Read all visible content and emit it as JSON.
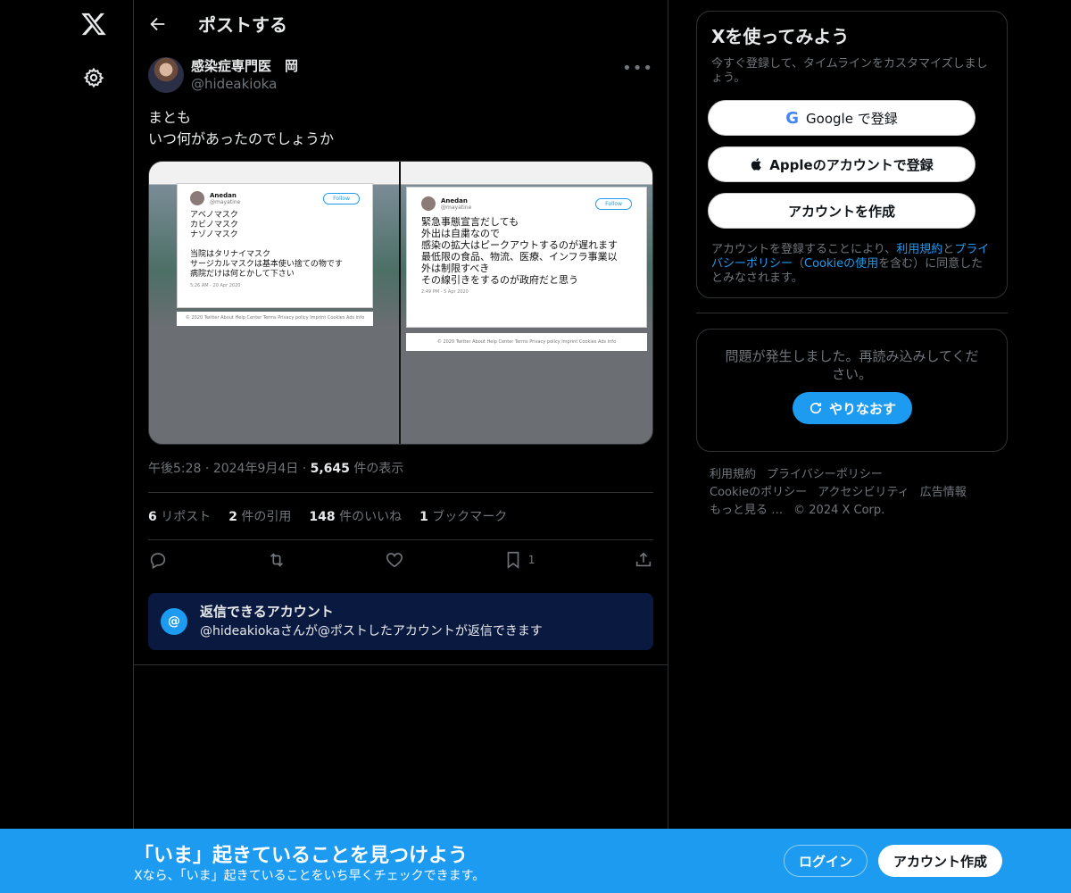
{
  "nav": {
    "logo": "X"
  },
  "header": {
    "title": "ポストする"
  },
  "tweet": {
    "display_name": "感染症専門医　岡",
    "handle": "@hideakioka",
    "text": "まとも\nいつ何があったのでしょうか",
    "time": "午後5:28",
    "date": "2024年9月4日",
    "views_count": "5,645",
    "views_label": "件の表示",
    "stats": {
      "reposts": "6",
      "reposts_label": "リポスト",
      "quotes": "2",
      "quotes_label": "件の引用",
      "likes": "148",
      "likes_label": "件のいいね",
      "bookmarks": "1",
      "bookmarks_label": "ブックマーク"
    },
    "bookmark_count": "1",
    "media": {
      "left": {
        "name": "Anedan",
        "handle": "@mayatine",
        "follow": "Follow",
        "text": "アベノマスク\nカビノマスク\nナゾノマスク\n\n当院はタリナイマスク\nサージカルマスクは基本使い捨ての物です\n病院だけは何とかして下さい",
        "date": "5:26 AM - 20 Apr 2020",
        "footer": "© 2020 Twitter  About  Help Center  Terms  Privacy policy  Imprint  Cookies  Ads info"
      },
      "right": {
        "name": "Anedan",
        "handle": "@mayatine",
        "follow": "Follow",
        "text": "緊急事態宣言だしても\n外出は自粛なので\n感染の拡大はピークアウトするのが遅れます\n最低限の食品、物流、医療、インフラ事業以\n外は制限すべき\nその線引きをするのが政府だと思う",
        "date": "2:49 PM - 5 Apr 2020",
        "footer": "© 2020 Twitter  About  Help Center  Terms  Privacy policy  Imprint  Cookies  Ads info"
      }
    }
  },
  "reply_restriction": {
    "icon": "@",
    "title": "返信できるアカウント",
    "subtitle": "@hideakiokaさんが@ポストしたアカウントが返信できます"
  },
  "signup_panel": {
    "title": "Xを使ってみよう",
    "subtitle": "今すぐ登録して、タイムラインをカスタマイズしましょう。",
    "google_button": "Google で登録",
    "apple_button": "Appleのアカウントで登録",
    "create_button": "アカウントを作成",
    "legal_pre": "アカウントを登録することにより、",
    "legal_terms": "利用規約",
    "legal_and": "と",
    "legal_privacy": "プライバシーポリシー",
    "legal_open": "（",
    "legal_cookie": "Cookieの使用",
    "legal_post": "を含む）に同意したとみなされます。"
  },
  "error_panel": {
    "message": "問題が発生しました。再読み込みしてください。",
    "retry_button": "やりなおす"
  },
  "footer_links": [
    "利用規約",
    "プライバシーポリシー",
    "Cookieのポリシー",
    "アクセシビリティ",
    "広告情報",
    "もっと見る …",
    "© 2024 X Corp."
  ],
  "bottom_bar": {
    "title": "「いま」起きていることを見つけよう",
    "subtitle": "Xなら、「いま」起きていることをいち早くチェックできます。",
    "login": "ログイン",
    "signup": "アカウント作成"
  },
  "colors": {
    "accent": "#1d9bf0",
    "background": "#000000",
    "reply_box": "#0a1940"
  }
}
